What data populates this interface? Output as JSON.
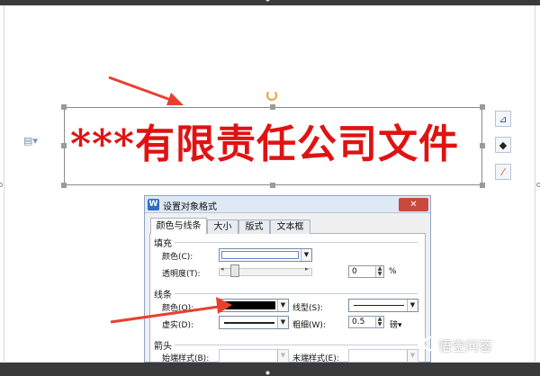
{
  "heading_text": "***有限责任公司文件",
  "dialog": {
    "title": "设置对象格式",
    "close_icon": "close-icon",
    "tabs": [
      {
        "label": "颜色与线条",
        "active": true
      },
      {
        "label": "大小",
        "active": false
      },
      {
        "label": "版式",
        "active": false
      },
      {
        "label": "文本框",
        "active": false
      }
    ],
    "fill": {
      "section": "填充",
      "color_label": "颜色(C):",
      "transparency_label": "透明度(T):",
      "transparency_value": "0",
      "percent": "%"
    },
    "line": {
      "section": "线条",
      "color_label": "颜色(O):",
      "style_label": "线型(S):",
      "dash_label": "虚实(D):",
      "weight_label": "粗细(W):",
      "weight_value": "0.5",
      "weight_unit": "磅▾"
    },
    "arrows": {
      "section": "箭头",
      "begin_label": "始端样式(B):",
      "end_label": "末端样式(E):"
    }
  },
  "side_tools": [
    "layout-options-icon",
    "fill-icon",
    "outline-icon"
  ],
  "colors": {
    "heading": "#e01212",
    "arrow": "#e8402f",
    "accent": "#2d6ec9"
  },
  "watermark": "悟空问答"
}
